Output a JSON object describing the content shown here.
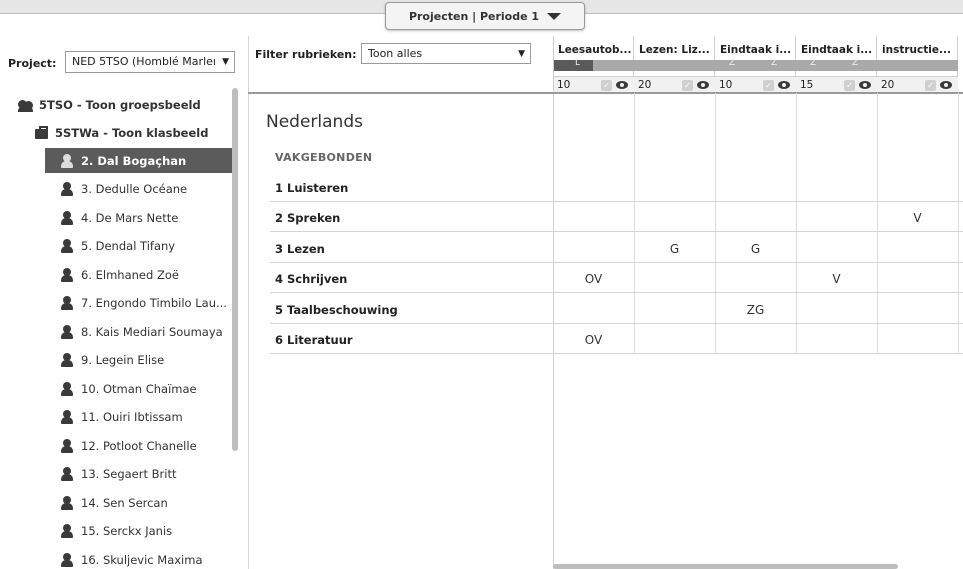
{
  "header": {
    "tab_label": "Projecten | Periode 1",
    "tab_icon": "caret-down-icon"
  },
  "project": {
    "label": "Project:",
    "value": "NED 5TSO (Homblé Marleı"
  },
  "tree": {
    "group": "5TSO - Toon groepsbeeld",
    "class": "5STWa - Toon klasbeeld",
    "students": [
      "2. Dal Bogaçhan",
      "3. Dedulle Océane",
      "4. De Mars Nette",
      "5. Dendal Tifany",
      "6. Elmhaned Zoë",
      "7. Engondo Timbilo Lau...",
      "8. Kais Mediari Soumaya",
      "9. Legein Elise",
      "10. Otman Chaïmae",
      "11. Ouiri Ibtissam",
      "12. Potloot Chanelle",
      "13. Segaert Britt",
      "14. Sen Sercan",
      "15. Serckx Janis",
      "16. Skuljevic Maxima"
    ],
    "selected_index": 0
  },
  "filter": {
    "label": "Filter rubrieken:",
    "value": "Toon alles"
  },
  "columns": [
    {
      "title": "Leesautob...",
      "weight": "10",
      "badges": [
        "L"
      ]
    },
    {
      "title": "Lezen: Liz...",
      "weight": "20",
      "badges": []
    },
    {
      "title": "Eindtaak i...",
      "weight": "10",
      "badges": [
        "Z",
        "Z"
      ]
    },
    {
      "title": "Eindtaak i...",
      "weight": "15",
      "badges": [
        "Z",
        "Z"
      ]
    },
    {
      "title": "instructie...",
      "weight": "20",
      "badges": []
    }
  ],
  "subject": "Nederlands",
  "section": "VAKGEBONDEN",
  "rows": [
    {
      "label": "1 Luisteren",
      "cells": [
        "",
        "",
        "",
        "",
        ""
      ]
    },
    {
      "label": "2 Spreken",
      "cells": [
        "",
        "",
        "",
        "",
        "V"
      ]
    },
    {
      "label": "3 Lezen",
      "cells": [
        "",
        "G",
        "G",
        "",
        ""
      ]
    },
    {
      "label": "4 Schrijven",
      "cells": [
        "OV",
        "",
        "",
        "V",
        ""
      ]
    },
    {
      "label": "5 Taalbeschouwing",
      "cells": [
        "",
        "",
        "ZG",
        "",
        ""
      ]
    },
    {
      "label": "6 Literatuur",
      "cells": [
        "OV",
        "",
        "",
        "",
        ""
      ]
    }
  ]
}
